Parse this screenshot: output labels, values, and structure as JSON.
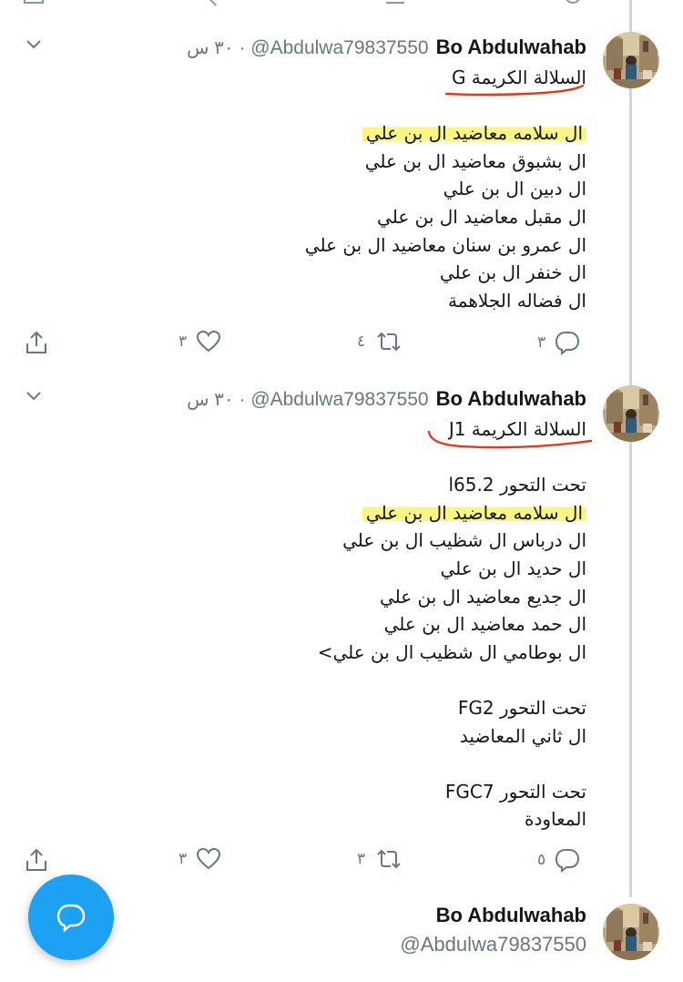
{
  "tweets": [
    {
      "display_name": "Bo Abdulwahab",
      "handle": "@Abdulwa79837550",
      "separator": "·",
      "time": "٣٠ س",
      "lines": [
        "السلالة الكريمة G",
        "",
        "ال سلامه معاضيد ال بن علي",
        "ال بشبوق معاضيد ال بن علي",
        "ال دبين ال بن علي",
        "ال مقبل معاضيد ال بن علي",
        "ال عمرو بن سنان معاضيد ال بن علي",
        "ال خنفر ال بن علي",
        "ال فضاله الجلاهمة"
      ],
      "reply_count": "٣",
      "retweet_count": "٤",
      "like_count": "٣"
    },
    {
      "display_name": "Bo Abdulwahab",
      "handle": "@Abdulwa79837550",
      "separator": "·",
      "time": "٣٠ س",
      "lines": [
        "السلالة الكريمة J1",
        "",
        "تحت التحور l65.2",
        "ال سلامه معاضيد ال بن علي",
        "ال درباس ال شظيب ال بن علي",
        "ال حديد ال بن علي",
        "ال جديع معاضيد ال بن علي",
        "ال حمد معاضيد ال بن علي",
        "ال بوطامي ال شظيب ال بن علي>",
        "",
        "تحت التحور FG2",
        "ال ثاني المعاضيد",
        "",
        "تحت التحور FGC7",
        "المعاودة"
      ],
      "reply_count": "٥",
      "retweet_count": "٣",
      "like_count": "٣"
    }
  ],
  "bottom_tweet": {
    "display_name": "Bo Abdulwahab",
    "handle": "@Abdulwa79837550"
  },
  "icons": {
    "menu": "chevron-down-icon",
    "reply": "reply-bubble-icon",
    "retweet": "retweet-icon",
    "like": "heart-icon",
    "share": "share-icon",
    "compose": "compose-icon"
  },
  "colors": {
    "accent": "#1da1f2",
    "secondary_text": "#657786",
    "highlight": "#faf36e",
    "annotation_red": "#e5391b"
  }
}
